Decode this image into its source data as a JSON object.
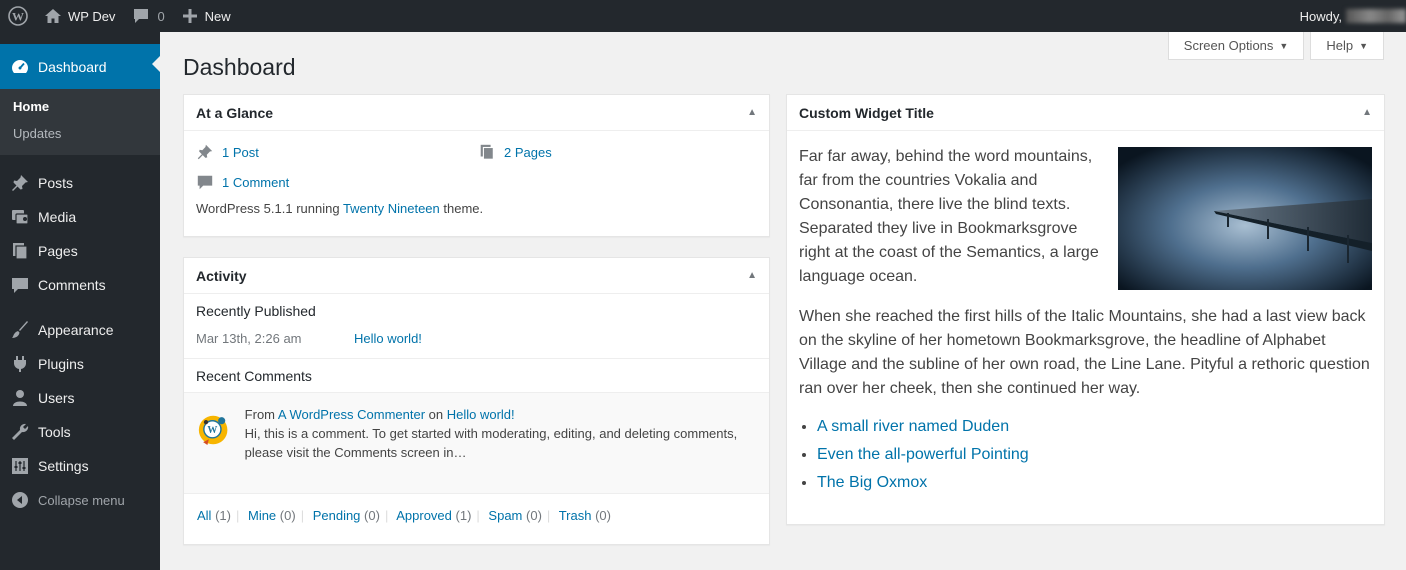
{
  "adminbar": {
    "site_name": "WP Dev",
    "comment_count": "0",
    "new_label": "New",
    "howdy": "Howdy,"
  },
  "menu": {
    "dashboard": "Dashboard",
    "submenu": [
      "Home",
      "Updates"
    ],
    "items": [
      {
        "label": "Posts",
        "icon": "pin-icon"
      },
      {
        "label": "Media",
        "icon": "media-icon"
      },
      {
        "label": "Pages",
        "icon": "pages-icon"
      },
      {
        "label": "Comments",
        "icon": "comment-icon"
      },
      {
        "label": "Appearance",
        "icon": "brush-icon"
      },
      {
        "label": "Plugins",
        "icon": "plugin-icon"
      },
      {
        "label": "Users",
        "icon": "users-icon"
      },
      {
        "label": "Tools",
        "icon": "wrench-icon"
      },
      {
        "label": "Settings",
        "icon": "settings-icon"
      }
    ],
    "collapse": "Collapse menu"
  },
  "screen_options": "Screen Options",
  "help": "Help",
  "page_title": "Dashboard",
  "glance": {
    "title": "At a Glance",
    "posts": "1 Post",
    "pages": "2 Pages",
    "comments": "1 Comment",
    "footer_pre": "WordPress 5.1.1 running ",
    "theme": "Twenty Nineteen",
    "footer_post": " theme."
  },
  "activity": {
    "title": "Activity",
    "recent_published": "Recently Published",
    "pub_date": "Mar 13th, 2:26 am",
    "pub_link": "Hello world!",
    "recent_comments": "Recent Comments",
    "comment": {
      "from": "From ",
      "author": "A WordPress Commenter",
      "on": " on ",
      "post": "Hello world!",
      "text": "Hi, this is a comment. To get started with moderating, editing, and deleting comments, please visit the Comments screen in…"
    },
    "filters": [
      {
        "label": "All",
        "count": "(1)"
      },
      {
        "label": "Mine",
        "count": "(0)"
      },
      {
        "label": "Pending",
        "count": "(0)"
      },
      {
        "label": "Approved",
        "count": "(1)"
      },
      {
        "label": "Spam",
        "count": "(0)"
      },
      {
        "label": "Trash",
        "count": "(0)"
      }
    ]
  },
  "custom_widget": {
    "title": "Custom Widget Title",
    "p1": "Far far away, behind the word mountains, far from the countries Vokalia and Consonantia, there live the blind texts. Separated they live in Bookmarksgrove right at the coast of the Semantics, a large language ocean.",
    "p2": "When she reached the first hills of the Italic Mountains, she had a last view back on the skyline of her hometown Bookmarksgrove, the headline of Alphabet Village and the subline of her own road, the Line Lane. Pityful a rethoric question ran over her cheek, then she continued her way.",
    "links": [
      "A small river named Duden",
      "Even the all-powerful Pointing",
      "The Big Oxmox"
    ]
  },
  "colors": {
    "adminbar_bg": "#23282d",
    "accent": "#0073aa",
    "link": "#0073aa",
    "page_bg": "#f1f1f1"
  }
}
